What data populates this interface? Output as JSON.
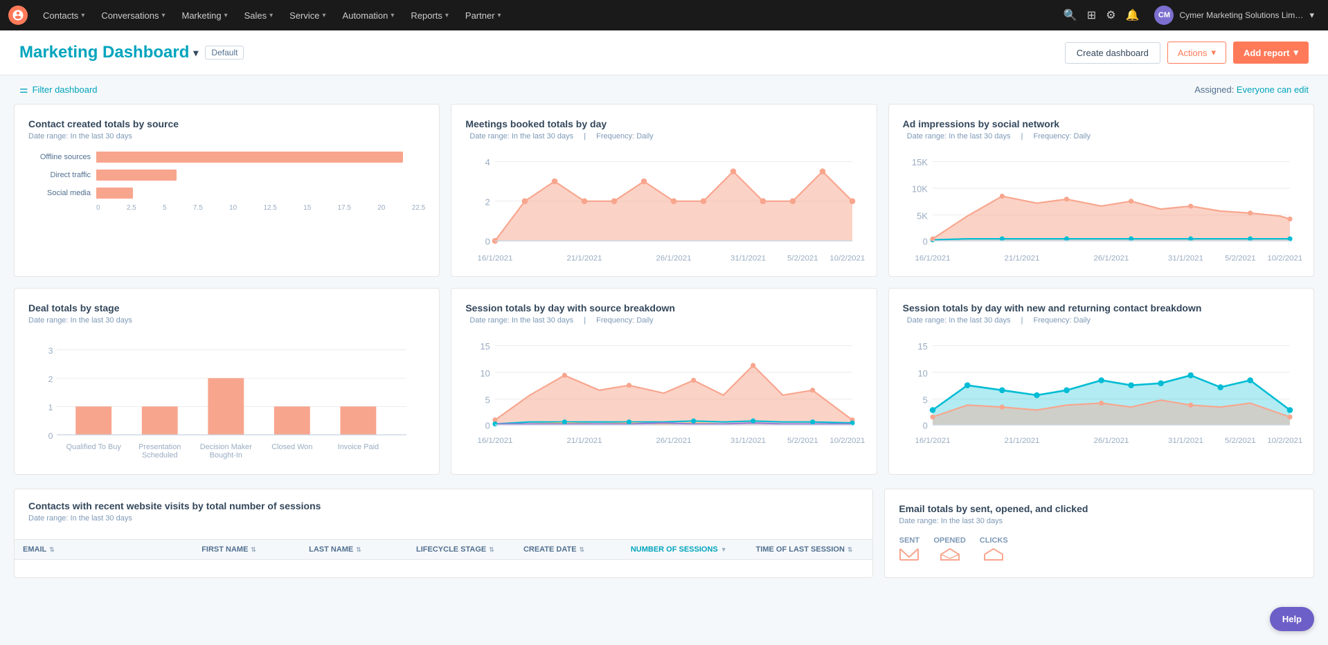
{
  "nav": {
    "logo_alt": "HubSpot",
    "items": [
      {
        "label": "Contacts",
        "has_dropdown": true
      },
      {
        "label": "Conversations",
        "has_dropdown": true
      },
      {
        "label": "Marketing",
        "has_dropdown": true
      },
      {
        "label": "Sales",
        "has_dropdown": true
      },
      {
        "label": "Service",
        "has_dropdown": true
      },
      {
        "label": "Automation",
        "has_dropdown": true
      },
      {
        "label": "Reports",
        "has_dropdown": true
      },
      {
        "label": "Partner",
        "has_dropdown": true
      }
    ],
    "account": "Cymer Marketing Solutions Limited",
    "avatar_initials": "CM"
  },
  "header": {
    "title": "Marketing Dashboard",
    "badge": "Default",
    "create_dashboard": "Create dashboard",
    "actions": "Actions",
    "add_report": "Add report"
  },
  "filter": {
    "label": "Filter dashboard",
    "assigned_label": "Assigned:",
    "assigned_value": "Everyone can edit"
  },
  "cards": {
    "contact_created": {
      "title": "Contact created totals by source",
      "subtitle": "Date range: In the last 30 days",
      "bars": [
        {
          "label": "Offline sources",
          "value": 21,
          "max": 22.5
        },
        {
          "label": "Direct traffic",
          "value": 5.5,
          "max": 22.5
        },
        {
          "label": "Social media",
          "value": 2.5,
          "max": 22.5
        }
      ],
      "axis": [
        "0",
        "2.5",
        "5",
        "7.5",
        "10",
        "12.5",
        "15",
        "17.5",
        "20",
        "22.5"
      ]
    },
    "meetings_booked": {
      "title": "Meetings booked totals by day",
      "subtitle": "Date range: In the last 30 days",
      "subtitle2": "Frequency: Daily",
      "y_max": 4,
      "y_labels": [
        "0",
        "2",
        "4"
      ],
      "x_labels": [
        "16/1/2021",
        "21/1/2021",
        "26/1/2021",
        "31/1/2021",
        "5/2/2021",
        "10/2/2021"
      ]
    },
    "ad_impressions": {
      "title": "Ad impressions by social network",
      "subtitle": "Date range: In the last 30 days",
      "subtitle2": "Frequency: Daily",
      "y_labels": [
        "0",
        "5K",
        "10K",
        "15K"
      ],
      "x_labels": [
        "16/1/2021",
        "21/1/2021",
        "26/1/2021",
        "31/1/2021",
        "5/2/2021",
        "10/2/2021"
      ]
    },
    "deal_totals": {
      "title": "Deal totals by stage",
      "subtitle": "Date range: In the last 30 days",
      "bars": [
        {
          "label": "Qualified To Buy",
          "value": 1
        },
        {
          "label": "Presentation Scheduled",
          "value": 1
        },
        {
          "label": "Decision Maker Bought-In",
          "value": 2
        },
        {
          "label": "Closed Won",
          "value": 1
        },
        {
          "label": "Invoice Paid",
          "value": 1
        }
      ],
      "y_labels": [
        "0",
        "1",
        "2",
        "3"
      ]
    },
    "session_source": {
      "title": "Session totals by day with source breakdown",
      "subtitle": "Date range: In the last 30 days",
      "subtitle2": "Frequency: Daily",
      "y_labels": [
        "0",
        "5",
        "10",
        "15"
      ],
      "x_labels": [
        "16/1/2021",
        "21/1/2021",
        "26/1/2021",
        "31/1/2021",
        "5/2/2021",
        "10/2/2021"
      ]
    },
    "session_contact": {
      "title": "Session totals by day with new and returning contact breakdown",
      "subtitle": "Date range: In the last 30 days",
      "subtitle2": "Frequency: Daily",
      "y_labels": [
        "0",
        "5",
        "10",
        "15"
      ],
      "x_labels": [
        "16/1/2021",
        "21/1/2021",
        "26/1/2021",
        "31/1/2021",
        "5/2/2021",
        "10/2/2021"
      ]
    },
    "contacts_table": {
      "title": "Contacts with recent website visits by total number of sessions",
      "subtitle": "Date range: In the last 30 days",
      "columns": [
        "EMAIL",
        "FIRST NAME",
        "LAST NAME",
        "LIFECYCLE STAGE",
        "CREATE DATE",
        "NUMBER OF SESSIONS",
        "TIME OF LAST SESSION"
      ]
    },
    "email_totals": {
      "title": "Email totals by sent, opened, and clicked",
      "subtitle": "Date range: In the last 30 days",
      "metrics": [
        "SENT",
        "OPENED",
        "CLICKS"
      ]
    }
  },
  "help": {
    "label": "Help"
  },
  "colors": {
    "salmon": "#f8a58d",
    "teal": "#00bcd4",
    "accent": "#ff7a59",
    "brand": "#00a4bd",
    "purple": "#9c7ed7",
    "yellow": "#f5c26b"
  }
}
